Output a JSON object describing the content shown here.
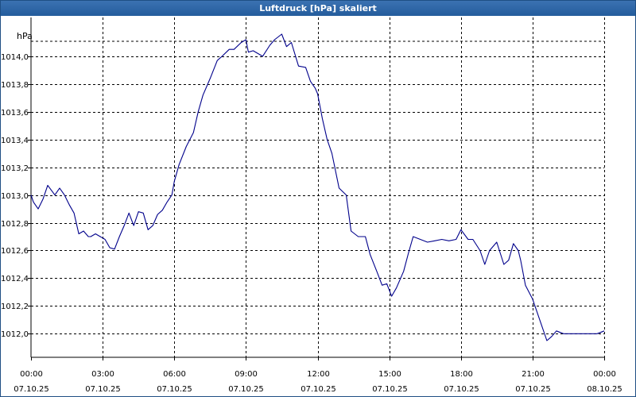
{
  "window": {
    "title": "Luftdruck [hPa] skaliert"
  },
  "chart_data": {
    "type": "line",
    "title": "Luftdruck [hPa] skaliert",
    "ylabel": "hPa",
    "ylim": [
      1011.83,
      1014.2
    ],
    "xlim_hours": [
      0,
      24
    ],
    "yticks": [
      {
        "value": 1012.0,
        "label": "1012,0"
      },
      {
        "value": 1012.2,
        "label": "1012,2"
      },
      {
        "value": 1012.4,
        "label": "1012,4"
      },
      {
        "value": 1012.6,
        "label": "1012,6"
      },
      {
        "value": 1012.8,
        "label": "1012,8"
      },
      {
        "value": 1013.0,
        "label": "1013,0"
      },
      {
        "value": 1013.2,
        "label": "1013,2"
      },
      {
        "value": 1013.4,
        "label": "1013,4"
      },
      {
        "value": 1013.6,
        "label": "1013,6"
      },
      {
        "value": 1013.8,
        "label": "1013,8"
      },
      {
        "value": 1014.0,
        "label": "1014,0"
      }
    ],
    "xticks": [
      {
        "hour": 0,
        "time": "00:00",
        "date": "07.10.25"
      },
      {
        "hour": 3,
        "time": "03:00",
        "date": "07.10.25"
      },
      {
        "hour": 6,
        "time": "06:00",
        "date": "07.10.25"
      },
      {
        "hour": 9,
        "time": "09:00",
        "date": "07.10.25"
      },
      {
        "hour": 12,
        "time": "12:00",
        "date": "07.10.25"
      },
      {
        "hour": 15,
        "time": "15:00",
        "date": "07.10.25"
      },
      {
        "hour": 18,
        "time": "18:00",
        "date": "07.10.25"
      },
      {
        "hour": 21,
        "time": "21:00",
        "date": "07.10.25"
      },
      {
        "hour": 24,
        "time": "00:00",
        "date": "08.10.25"
      }
    ],
    "grid": true,
    "line_color": "#00008b",
    "series": [
      {
        "x": [
          0.0,
          0.1,
          0.3,
          0.5,
          0.7,
          1.0,
          1.2,
          1.4,
          1.6,
          1.8,
          2.0,
          2.2,
          2.4,
          2.5,
          2.7,
          2.9,
          3.1,
          3.3,
          3.5,
          3.7,
          3.9,
          4.1,
          4.3,
          4.5,
          4.7,
          4.9,
          5.1,
          5.3,
          5.5,
          5.7,
          5.9,
          6.0,
          6.2,
          6.5,
          6.8,
          7.0,
          7.2,
          7.5,
          7.8,
          8.0,
          8.3,
          8.5,
          8.8,
          9.0,
          9.1,
          9.3,
          9.5,
          9.7,
          10.0,
          10.2,
          10.5,
          10.7,
          10.9,
          11.2,
          11.5,
          11.7,
          11.9,
          12.0,
          12.2,
          12.4,
          12.6,
          12.9,
          13.2,
          13.4,
          13.7,
          14.0,
          14.2,
          14.5,
          14.7,
          14.9,
          15.1,
          15.3,
          15.6,
          15.8,
          16.0,
          16.3,
          16.6,
          16.9,
          17.2,
          17.5,
          17.8,
          18.0,
          18.3,
          18.5,
          18.8,
          19.0,
          19.2,
          19.5,
          19.8,
          20.0,
          20.2,
          20.4,
          20.5,
          20.7,
          21.0,
          21.3,
          21.6,
          21.8,
          22.0,
          22.3,
          22.5,
          22.7,
          22.9,
          23.1,
          23.3,
          23.5,
          23.7,
          24.0
        ],
        "y": [
          1013.0,
          1012.95,
          1012.9,
          1012.97,
          1013.07,
          1013.0,
          1013.05,
          1013.0,
          1012.93,
          1012.87,
          1012.72,
          1012.74,
          1012.7,
          1012.7,
          1012.72,
          1012.7,
          1012.68,
          1012.62,
          1012.61,
          1012.7,
          1012.78,
          1012.87,
          1012.78,
          1012.88,
          1012.87,
          1012.75,
          1012.78,
          1012.86,
          1012.89,
          1012.95,
          1013.0,
          1013.1,
          1013.22,
          1013.35,
          1013.45,
          1013.6,
          1013.72,
          1013.84,
          1013.97,
          1014.0,
          1014.05,
          1014.05,
          1014.1,
          1014.12,
          1014.03,
          1014.04,
          1014.02,
          1014.0,
          1014.08,
          1014.12,
          1014.16,
          1014.07,
          1014.1,
          1013.93,
          1013.92,
          1013.82,
          1013.77,
          1013.73,
          1013.55,
          1013.4,
          1013.3,
          1013.05,
          1013.0,
          1012.74,
          1012.7,
          1012.7,
          1012.57,
          1012.44,
          1012.35,
          1012.36,
          1012.27,
          1012.33,
          1012.45,
          1012.58,
          1012.7,
          1012.68,
          1012.66,
          1012.67,
          1012.68,
          1012.67,
          1012.68,
          1012.75,
          1012.68,
          1012.68,
          1012.6,
          1012.5,
          1012.6,
          1012.66,
          1012.5,
          1012.53,
          1012.65,
          1012.6,
          1012.53,
          1012.35,
          1012.25,
          1012.1,
          1011.95,
          1011.98,
          1012.02,
          1012.0,
          1012.0,
          1012.0,
          1012.0,
          1012.0,
          1012.0,
          1012.0,
          1012.0,
          1012.02
        ]
      }
    ]
  }
}
